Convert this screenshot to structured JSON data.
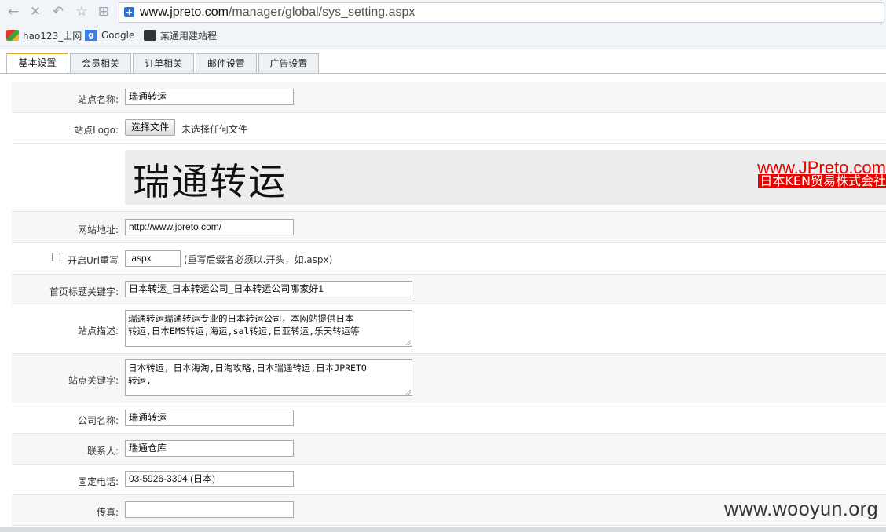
{
  "browser": {
    "url_domain": "www.jpreto.com",
    "url_path": "/manager/global/sys_setting.aspx",
    "bookmarks": [
      {
        "label": "hao123_上网",
        "icon": "hao123-icon"
      },
      {
        "label": "Google",
        "icon": "google-icon"
      },
      {
        "label": "某通用建站程",
        "icon": "site-builder-icon"
      }
    ]
  },
  "tabs": [
    {
      "label": "基本设置",
      "active": true
    },
    {
      "label": "会员相关",
      "active": false
    },
    {
      "label": "订单相关",
      "active": false
    },
    {
      "label": "邮件设置",
      "active": false
    },
    {
      "label": "广告设置",
      "active": false
    }
  ],
  "form": {
    "site_name": {
      "label": "站点名称:",
      "value": "瑞通转运"
    },
    "site_logo": {
      "label": "站点Logo:",
      "button": "选择文件",
      "status": "未选择任何文件"
    },
    "logo_banner": {
      "title": "瑞通转运",
      "site": "www.JPreto.com",
      "company": "日本KEN贸易株式会社"
    },
    "site_url": {
      "label": "网站地址:",
      "value": "http://www.jpreto.com/"
    },
    "url_rewrite": {
      "label": "开启Url重写",
      "value": ".aspx",
      "hint": "(重写后缀名必须以.开头，如.aspx)"
    },
    "home_title": {
      "label": "首页标题关键字:",
      "value": "日本转运_日本转运公司_日本转运公司哪家好1"
    },
    "site_desc": {
      "label": "站点描述:",
      "lines": [
        "瑞通转运瑞通转运专业的日本转运公司，本网站提供日本",
        "转运,日本EMS转运,海运,sal转运,日亚转运,乐天转运等"
      ]
    },
    "site_keywords": {
      "label": "站点关键字:",
      "lines": [
        "日本转运，日本海淘,日淘攻略,日本瑞通转运,日本JPRETO",
        "转运,"
      ]
    },
    "company_name": {
      "label": "公司名称:",
      "value": "瑞通转运"
    },
    "contact": {
      "label": "联系人:",
      "value": "瑞通仓库"
    },
    "phone": {
      "label": "固定电话:",
      "value": "03-5926-3394 (日本)"
    },
    "fax": {
      "label": "传真:",
      "value": ""
    }
  },
  "watermark": "www.wooyun.org"
}
